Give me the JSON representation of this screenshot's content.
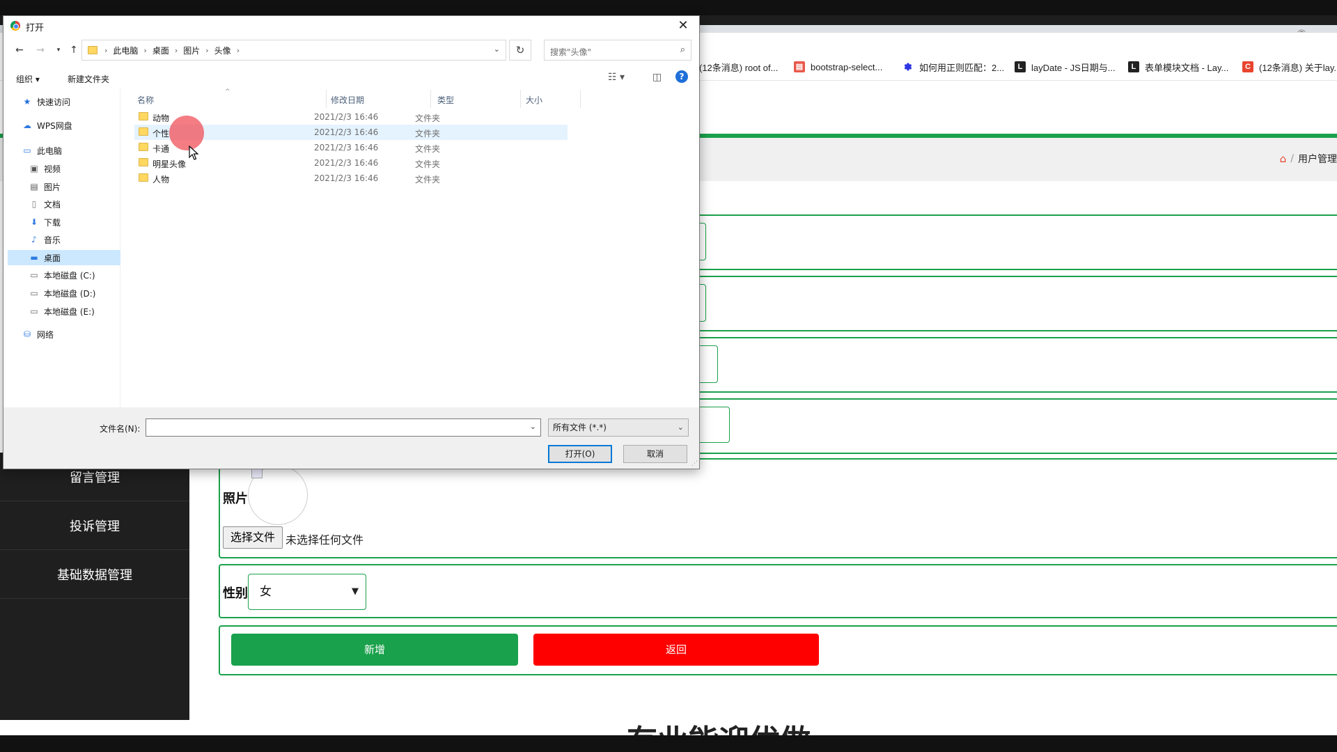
{
  "browser": {
    "bookmarks": [
      {
        "label": "(12条消息) root of...",
        "icon": "csdn-icon",
        "color": "#999999",
        "glyph": ""
      },
      {
        "label": "bootstrap-select...",
        "icon": "bootstrap-icon",
        "color": "#e8594b",
        "glyph": "▤"
      },
      {
        "label": "如何用正则匹配：2...",
        "icon": "baidu-paw-icon",
        "color": "#2932e1",
        "glyph": "✽"
      },
      {
        "label": "layDate - JS日期与...",
        "icon": "layui-icon",
        "color": "#222222",
        "glyph": "L"
      },
      {
        "label": "表单模块文档 - Lay...",
        "icon": "layui-icon",
        "color": "#222222",
        "glyph": "L"
      },
      {
        "label": "(12条消息) 关于lay...",
        "icon": "csdn-icon",
        "color": "#e8442f",
        "glyph": "C"
      }
    ],
    "breadcrumb": {
      "home_icon": "home-icon",
      "separator": "/",
      "current": "用户管理"
    }
  },
  "app": {
    "sidebar": [
      "留言管理",
      "投诉管理",
      "基础数据管理"
    ],
    "photo_label": "照片",
    "file_button": "选择文件",
    "file_status": "未选择任何文件",
    "gender_label": "性别",
    "gender_value": "女",
    "add_button": "新增",
    "back_button": "返回",
    "footer_text": "有业能迎优做"
  },
  "dialog": {
    "title": "打开",
    "close": "✕",
    "address": [
      "此电脑",
      "桌面",
      "图片",
      "头像"
    ],
    "search_placeholder": "搜索\"头像\"",
    "organize": "组织 ▾",
    "new_folder": "新建文件夹",
    "help": "?",
    "nav_pane": [
      {
        "label": "快速访问",
        "icon": "star-icon",
        "indent": 0
      },
      {
        "label": "WPS网盘",
        "icon": "cloud-icon",
        "indent": 0
      },
      {
        "label": "此电脑",
        "icon": "computer-icon",
        "indent": 0
      },
      {
        "label": "视频",
        "icon": "video-icon",
        "indent": 1
      },
      {
        "label": "图片",
        "icon": "picture-icon",
        "indent": 1
      },
      {
        "label": "文档",
        "icon": "document-icon",
        "indent": 1
      },
      {
        "label": "下载",
        "icon": "download-icon",
        "indent": 1
      },
      {
        "label": "音乐",
        "icon": "music-icon",
        "indent": 1
      },
      {
        "label": "桌面",
        "icon": "desktop-icon",
        "indent": 1,
        "selected": true
      },
      {
        "label": "本地磁盘 (C:)",
        "icon": "drive-icon",
        "indent": 1
      },
      {
        "label": "本地磁盘 (D:)",
        "icon": "drive-icon",
        "indent": 1
      },
      {
        "label": "本地磁盘 (E:)",
        "icon": "drive-icon",
        "indent": 1
      },
      {
        "label": "网络",
        "icon": "network-icon",
        "indent": 0
      }
    ],
    "columns": [
      "名称",
      "修改日期",
      "类型",
      "大小"
    ],
    "files": [
      {
        "name": "动物",
        "date": "2021/2/3 16:46",
        "type": "文件夹"
      },
      {
        "name": "个性",
        "date": "2021/2/3 16:46",
        "type": "文件夹",
        "highlighted": true
      },
      {
        "name": "卡通",
        "date": "2021/2/3 16:46",
        "type": "文件夹"
      },
      {
        "name": "明星头像",
        "date": "2021/2/3 16:46",
        "type": "文件夹"
      },
      {
        "name": "人物",
        "date": "2021/2/3 16:46",
        "type": "文件夹"
      }
    ],
    "filename_label": "文件名(N):",
    "filename_value": "",
    "filetype": "所有文件 (*.*)",
    "open_button": "打开(O)",
    "cancel_button": "取消"
  },
  "colors": {
    "accent_green": "#1aa14b",
    "back_red": "#ff0000",
    "dialog_selection": "#cce8ff"
  }
}
